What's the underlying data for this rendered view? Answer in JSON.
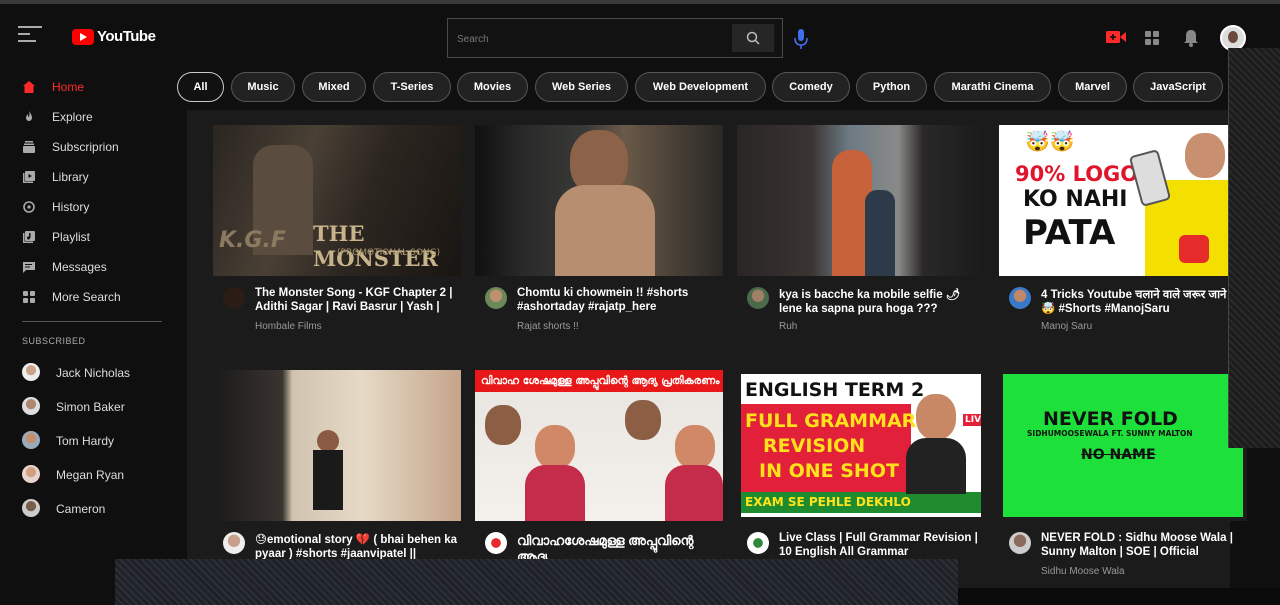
{
  "app": {
    "logo_text": "YouTube"
  },
  "search": {
    "placeholder": "Search"
  },
  "sidebar": {
    "nav": [
      {
        "label": "Home",
        "icon": "home-icon",
        "active": true
      },
      {
        "label": "Explore",
        "icon": "explore-icon"
      },
      {
        "label": "Subscriprion",
        "icon": "subscriptions-icon"
      },
      {
        "label": "Library",
        "icon": "library-icon"
      },
      {
        "label": "History",
        "icon": "history-icon"
      },
      {
        "label": "Playlist",
        "icon": "playlist-icon"
      },
      {
        "label": "Messages",
        "icon": "messages-icon"
      },
      {
        "label": "More Search",
        "icon": "more-icon"
      }
    ],
    "subscribed_title": "SUBSCRIBED",
    "subscriptions": [
      {
        "name": "Jack Nicholas"
      },
      {
        "name": "Simon Baker"
      },
      {
        "name": "Tom Hardy"
      },
      {
        "name": "Megan Ryan"
      },
      {
        "name": "Cameron"
      }
    ]
  },
  "chips": [
    "All",
    "Music",
    "Mixed",
    "T-Series",
    "Movies",
    "Web Series",
    "Web Development",
    "Comedy",
    "Python",
    "Marathi Cinema",
    "Marvel",
    "JavaScript"
  ],
  "videos": [
    {
      "title": "The Monster Song - KGF Chapter 2 | Adithi Sagar | Ravi Basrur | Yash |",
      "channel": "Hombale Films",
      "thumb_text": [
        "K.G.F",
        "THE MONSTER",
        "(PROMOTIONAL SONG)"
      ]
    },
    {
      "title": "Chomtu ki chowmein !! #shorts #ashortaday #rajatp_here",
      "channel": "Rajat shorts !!"
    },
    {
      "title": "kya is bacche ka mobile selfie 🌶 lene ka sapna pura hoga ???",
      "channel": "Ruh"
    },
    {
      "title": "4 Tricks Youtube चलाने वाले जरूर जाने 🤯🤯 #Shorts #ManojSaru",
      "channel": "Manoj Saru",
      "thumb_text": [
        "🤯🤯",
        "90% LOGO",
        "KO NAHI",
        "PATA"
      ]
    },
    {
      "title": "😓emotional story 💔 ( bhai behen ka pyaar ) #shorts #jaanvipatel ||",
      "channel": ""
    },
    {
      "title": "വിവാഹശേഷമുള്ള അപ്പുവിന്റെ ആദ്യ",
      "channel": "",
      "thumb_text": [
        "വിവാഹ ശേഷമുള്ള അപ്പുവിന്റെ ആദ്യ പ്രതികരണം"
      ]
    },
    {
      "title": "Live Class | Full Grammar Revision | 10 English All Grammar",
      "channel": "",
      "thumb_text": [
        "ENGLISH TERM 2",
        "FULL GRAMMAR",
        "REVISION",
        "IN ONE SHOT",
        "EXAM SE PEHLE DEKHLO",
        "LIVE"
      ]
    },
    {
      "title": "NEVER FOLD : Sidhu Moose Wala | Sunny Malton | SOE | Official",
      "channel": "Sidhu Moose Wala",
      "thumb_text": [
        "NEVER FOLD",
        "SIDHUMOOSEWALA FT. SUNNY MALTON",
        "NO NAME"
      ]
    }
  ]
}
